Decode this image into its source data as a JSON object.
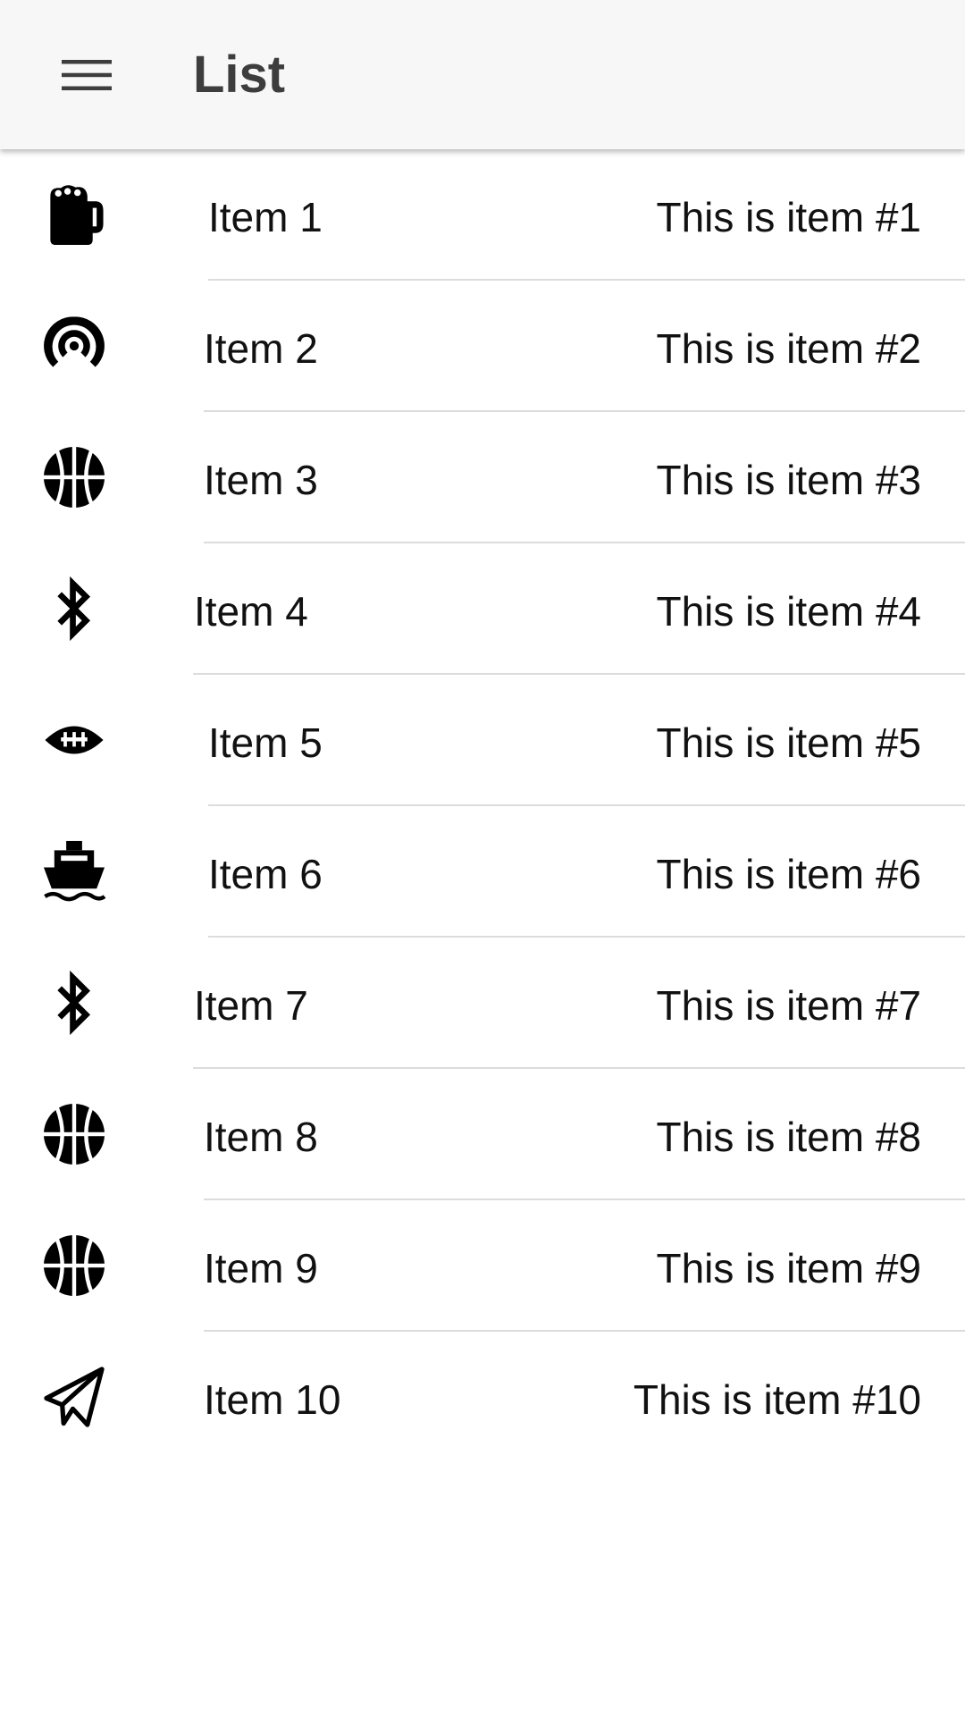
{
  "appbar": {
    "title": "List",
    "menu_icon": "hamburger-menu-icon"
  },
  "colors": {
    "appbar_bg": "#f7f7f7",
    "title_text": "#3d3d3d",
    "item_text": "#111111",
    "divider": "#dcdcdc",
    "icon": "#000000"
  },
  "items": [
    {
      "title": "Item 1",
      "subtitle": "This is item #1",
      "icon": "beer-mug-icon"
    },
    {
      "title": "Item 2",
      "subtitle": "This is item #2",
      "icon": "broadcast-signal-icon"
    },
    {
      "title": "Item 3",
      "subtitle": "This is item #3",
      "icon": "basketball-icon"
    },
    {
      "title": "Item 4",
      "subtitle": "This is item #4",
      "icon": "bluetooth-icon"
    },
    {
      "title": "Item 5",
      "subtitle": "This is item #5",
      "icon": "football-icon"
    },
    {
      "title": "Item 6",
      "subtitle": "This is item #6",
      "icon": "ship-icon"
    },
    {
      "title": "Item 7",
      "subtitle": "This is item #7",
      "icon": "bluetooth-icon"
    },
    {
      "title": "Item 8",
      "subtitle": "This is item #8",
      "icon": "basketball-icon"
    },
    {
      "title": "Item 9",
      "subtitle": "This is item #9",
      "icon": "basketball-icon"
    },
    {
      "title": "Item 10",
      "subtitle": "This is item #10",
      "icon": "paper-plane-icon"
    }
  ]
}
